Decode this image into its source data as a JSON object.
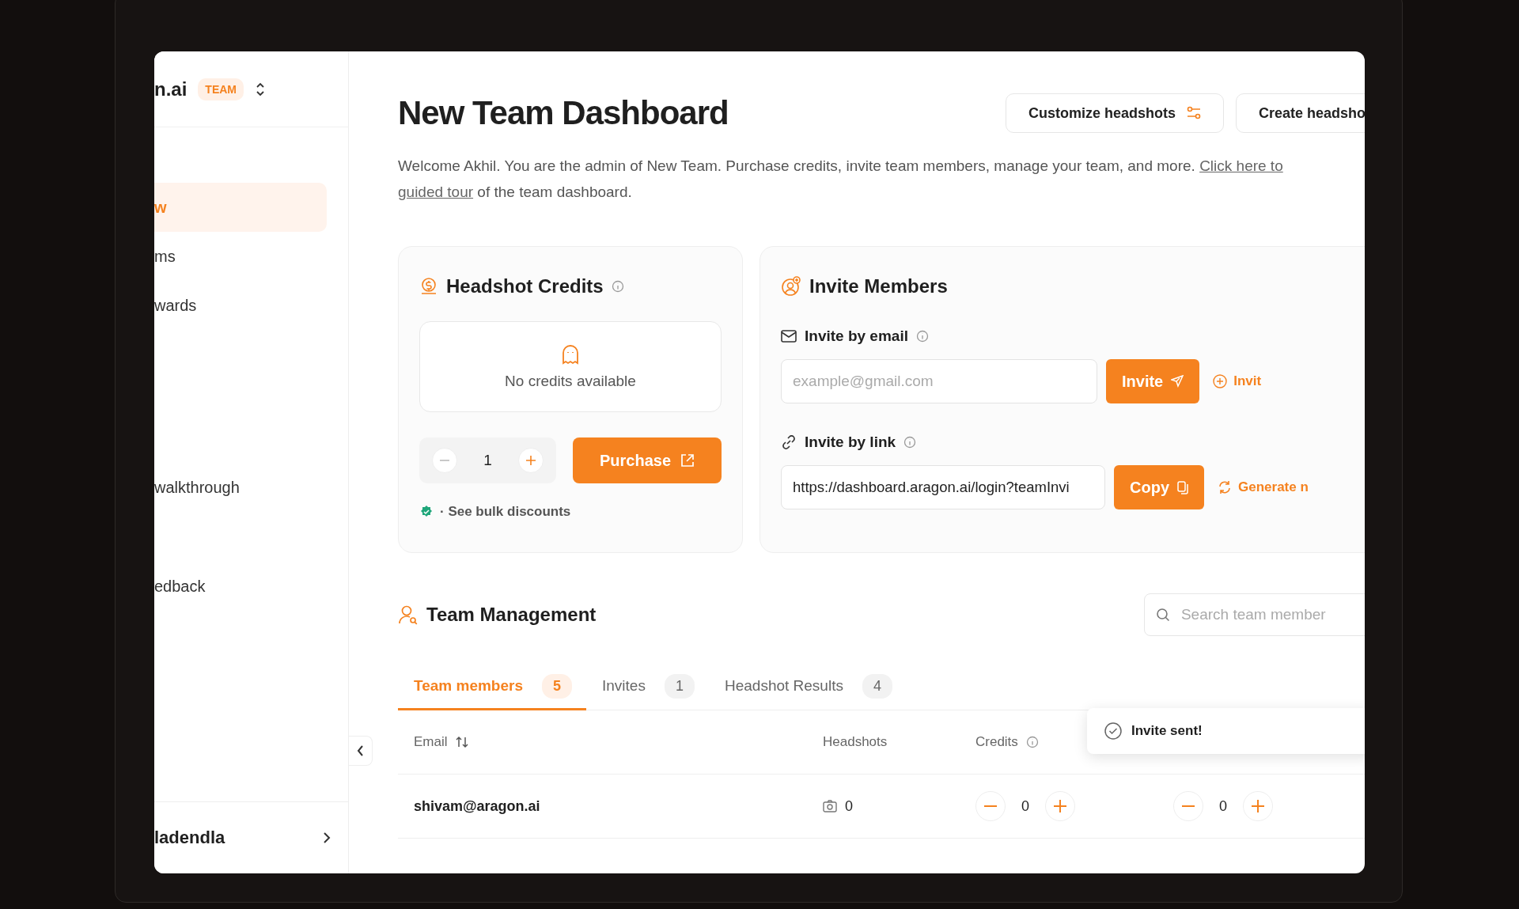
{
  "sidebar": {
    "brand": "n.ai",
    "plan_badge": "TEAM",
    "items": [
      {
        "label": "w",
        "selected": true
      },
      {
        "label": "ms",
        "selected": false
      },
      {
        "label": "wards",
        "selected": false
      },
      {
        "label": "walkthrough",
        "selected": false
      },
      {
        "label": "edback",
        "selected": false
      }
    ],
    "user": "ladendla"
  },
  "header": {
    "title": "New Team Dashboard",
    "buttons": [
      {
        "label": "Customize headshots",
        "kind": "sliders"
      },
      {
        "label": "Create headsho",
        "kind": "plain"
      }
    ],
    "welcome": {
      "text": "Welcome Akhil. You are the admin of New Team. Purchase credits, invite team members, manage your team, and more. ",
      "link_1": "Click here to",
      "link_2": "guided tour",
      "text_2": " of the team dashboard."
    }
  },
  "credits_card": {
    "title": "Headshot Credits",
    "empty_text": "No credits available",
    "quantity": "1",
    "purchase": "Purchase",
    "bulk_link": "· See bulk discounts"
  },
  "invite_card": {
    "title": "Invite Members",
    "email": {
      "label": "Invite by email",
      "placeholder": "example@gmail.com",
      "button": "Invite",
      "secondary": "Invit"
    },
    "link": {
      "label": "Invite by link",
      "value": "https://dashboard.aragon.ai/login?teamInvi",
      "button": "Copy",
      "secondary": "Generate n"
    }
  },
  "team": {
    "title": "Team Management",
    "search_placeholder": "Search team member",
    "tabs": [
      {
        "label": "Team members",
        "count": "5",
        "selected": true
      },
      {
        "label": "Invites",
        "count": "1",
        "selected": false
      },
      {
        "label": "Headshot Results",
        "count": "4",
        "selected": false
      }
    ],
    "columns": [
      "Email",
      "Headshots",
      "Credits"
    ],
    "rows": [
      {
        "email": "shivam@aragon.ai",
        "headshots": "0",
        "credits": "0",
        "edit_credits": "0"
      }
    ]
  },
  "toast": "Invite sent!"
}
